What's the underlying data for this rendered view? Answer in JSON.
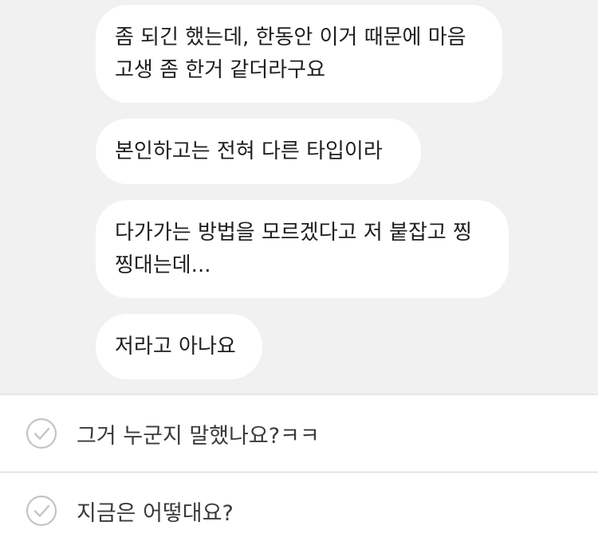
{
  "messages": [
    {
      "text": "좀 되긴 했는데, 한동안 이거 때문에 마음\n고생 좀 한거 같더라구요"
    },
    {
      "text": "본인하고는 전혀 다른 타입이라"
    },
    {
      "text": "다가가는 방법을 모르겠다고 저 붙잡고 찡\n찡대는데..."
    },
    {
      "text": "저라고 아나요"
    }
  ],
  "replies": [
    {
      "text": "그거 누군지 말했나요?ㅋㅋ",
      "icon": "check-circle-icon"
    },
    {
      "text": "지금은 어떻대요?",
      "icon": "check-circle-icon"
    }
  ],
  "colors": {
    "chat_background": "#f1f1f1",
    "bubble": "#ffffff",
    "check_icon": "#c4c4c4"
  }
}
